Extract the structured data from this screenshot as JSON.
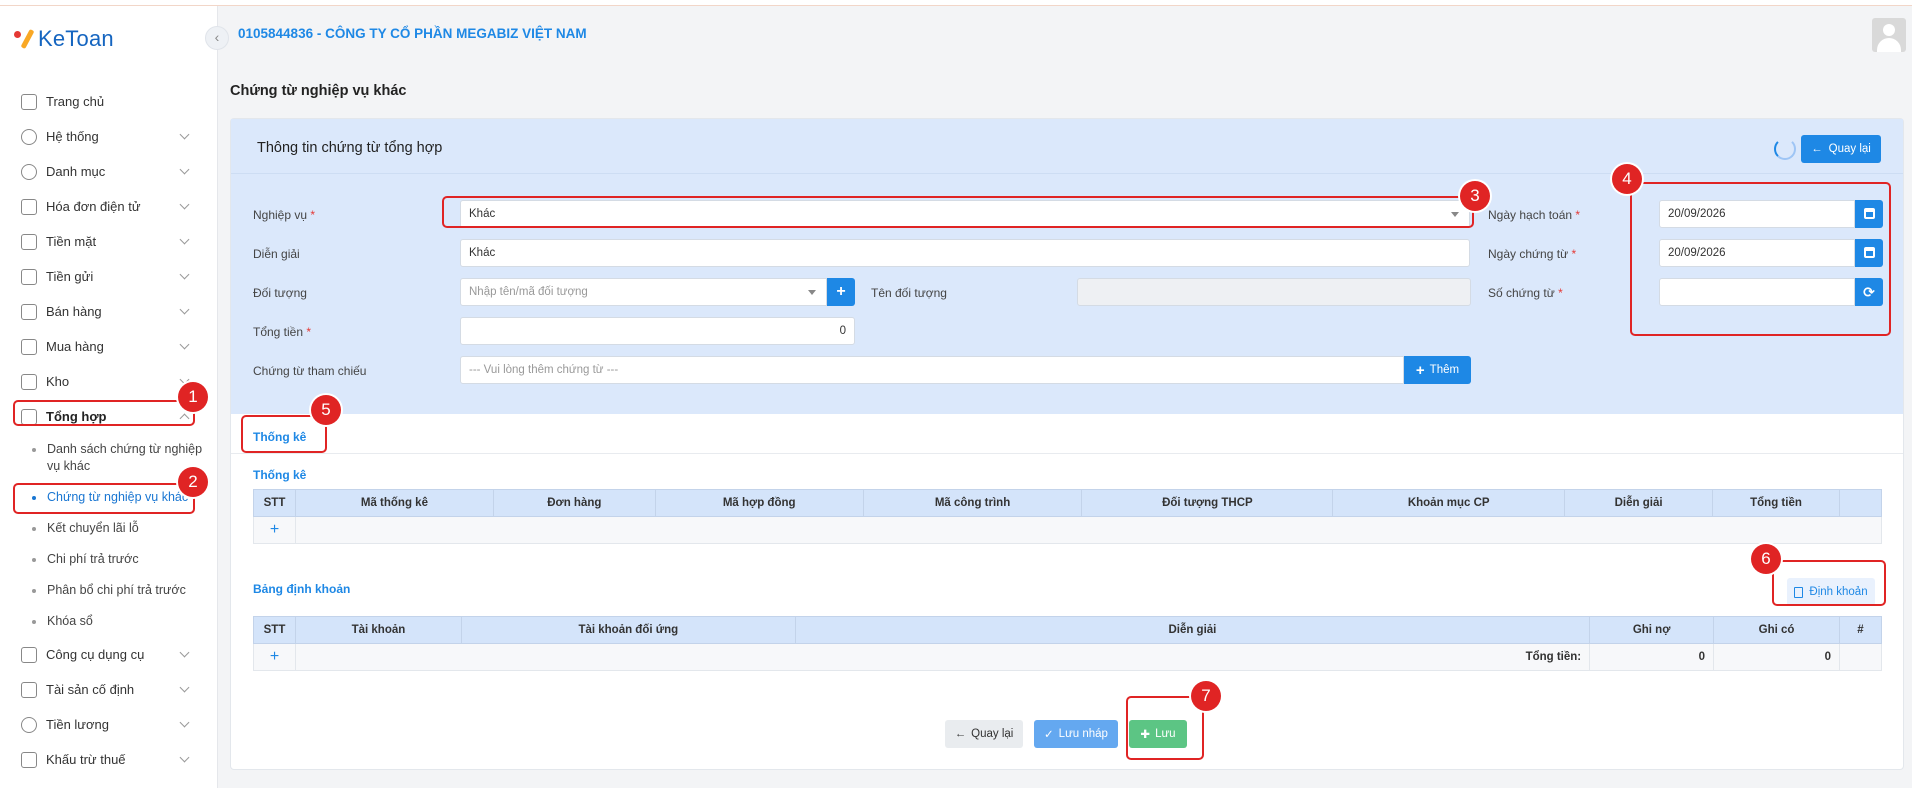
{
  "app": {
    "logo_text": "KeToan",
    "company": "0105844836 - CÔNG TY CỔ PHẦN MEGABIZ VIỆT NAM",
    "page_title": "Chứng từ nghiệp vụ khác"
  },
  "sidebar": {
    "items": [
      {
        "label": "Trang chủ",
        "icon": "home-icon"
      },
      {
        "label": "Hệ thống",
        "icon": "gear-icon"
      },
      {
        "label": "Danh mục",
        "icon": "grid-icon"
      },
      {
        "label": "Hóa đơn điện tử",
        "icon": "invoice-icon"
      },
      {
        "label": "Tiền mặt",
        "icon": "cash-icon"
      },
      {
        "label": "Tiền gửi",
        "icon": "bank-deposit-icon"
      },
      {
        "label": "Bán hàng",
        "icon": "sales-icon"
      },
      {
        "label": "Mua hàng",
        "icon": "purchase-icon"
      },
      {
        "label": "Kho",
        "icon": "warehouse-icon"
      },
      {
        "label": "Tổng hợp",
        "icon": "chart-line-icon"
      }
    ],
    "sub_items": [
      "Danh sách chứng từ nghiệp vụ khác",
      "Chứng từ nghiệp vụ khác",
      "Kết chuyển lãi lỗ",
      "Chi phí trả trước",
      "Phân bổ chi phí trả trước",
      "Khóa sổ"
    ],
    "items_after": [
      {
        "label": "Công cụ dụng cụ",
        "icon": "tools-icon"
      },
      {
        "label": "Tài sản cố định",
        "icon": "car-icon"
      },
      {
        "label": "Tiền lương",
        "icon": "salary-icon"
      },
      {
        "label": "Khấu trừ thuế",
        "icon": "tax-icon"
      }
    ]
  },
  "form": {
    "header_title": "Thông tin chứng từ tổng hợp",
    "back_label": "Quay lại",
    "nghiep_vu_label": "Nghiệp vụ",
    "nghiep_vu_value": "Khác",
    "dien_giai_label": "Diễn giải",
    "dien_giai_value": "Khác",
    "doi_tuong_label": "Đối tượng",
    "doi_tuong_placeholder": "Nhập tên/mã đối tượng",
    "ten_doi_tuong_label": "Tên đối tượng",
    "tong_tien_label": "Tổng tiền",
    "tong_tien_value": "0",
    "ct_tham_chieu_label": "Chứng từ tham chiếu",
    "ct_tham_chieu_placeholder": "--- Vui lòng thêm chứng từ ---",
    "them_label": "Thêm",
    "ngay_hach_toan_label": "Ngày hạch toán",
    "ngay_hach_toan_value": "20/09/2026",
    "ngay_chung_tu_label": "Ngày chứng từ",
    "ngay_chung_tu_value": "20/09/2026",
    "so_chung_tu_label": "Số chứng từ",
    "so_chung_tu_value": "",
    "required_mark": "*"
  },
  "tabs": {
    "thong_ke_tab": "Thống kê",
    "thong_ke_title": "Thống kê",
    "thong_ke_columns": [
      "STT",
      "Mã thống kê",
      "Đơn hàng",
      "Mã hợp đồng",
      "Mã công trình",
      "Đối tượng THCP",
      "Khoản mục CP",
      "Diễn giải",
      "Tổng tiền",
      ""
    ],
    "dinh_khoan_title": "Bảng định khoản",
    "dinh_khoan_button": "Định khoản",
    "dinh_khoan_columns": [
      "STT",
      "Tài khoản",
      "Tài khoản đối ứng",
      "Diễn giải",
      "Ghi nợ",
      "Ghi có",
      "#"
    ],
    "total_label": "Tổng tiền:",
    "total_no": "0",
    "total_co": "0",
    "add_row": "+"
  },
  "footer": {
    "back": "Quay lại",
    "draft": "Lưu nháp",
    "save": "Lưu"
  },
  "annotations": [
    "1",
    "2",
    "3",
    "4",
    "5",
    "6",
    "7"
  ],
  "colors": {
    "primary": "#1e88e5",
    "form_bg": "#dbe8fb",
    "annotation": "#e02424",
    "save": "#5cc584"
  }
}
